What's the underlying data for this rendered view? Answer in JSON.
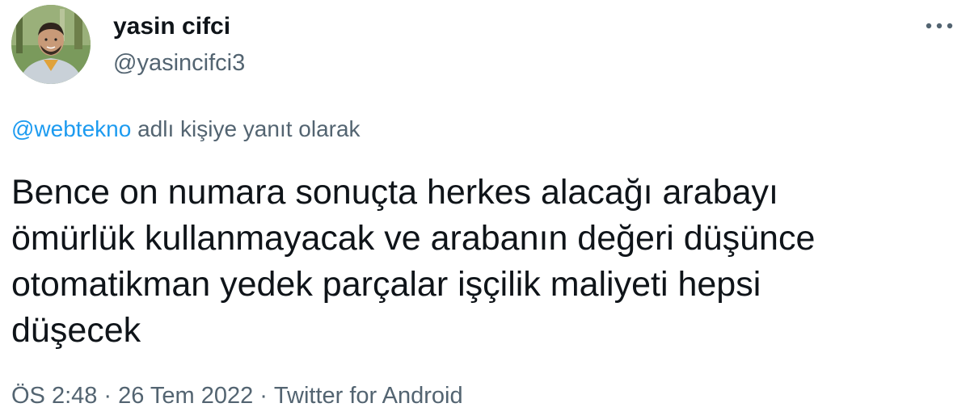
{
  "author": {
    "display_name": "yasin cifci",
    "handle": "@yasincifci3"
  },
  "reply_context": {
    "mention": "@webtekno",
    "suffix": " adlı kişiye yanıt olarak"
  },
  "tweet": {
    "text": "Bence on numara sonuçta herkes alacağı arabayı\nömürlük kullanmayacak ve arabanın değeri düşünce\notomatikman yedek parçalar işçilik maliyeti hepsi\ndüşecek"
  },
  "meta": {
    "time": "ÖS 2:48",
    "date": "26 Tem 2022",
    "source": "Twitter for Android",
    "separator": "·"
  },
  "icons": {
    "more": "more-horizontal-icon",
    "avatar": "avatar-photo"
  },
  "colors": {
    "text_primary": "#0f1419",
    "text_secondary": "#536471",
    "link": "#1d9bf0",
    "background": "#ffffff"
  }
}
